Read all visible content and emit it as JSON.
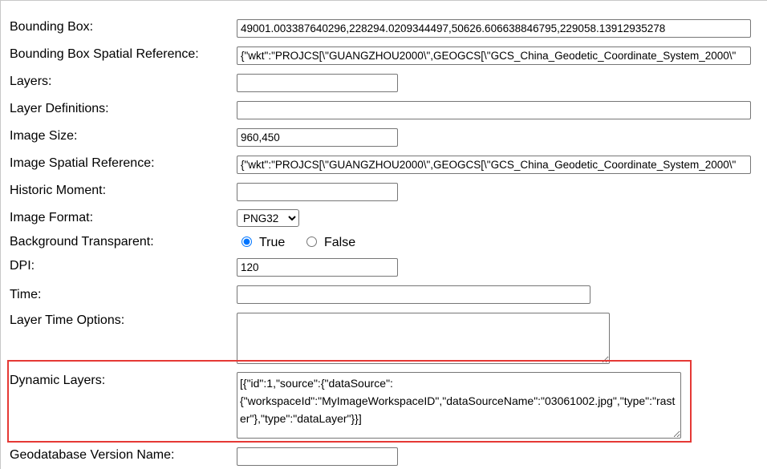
{
  "fields": {
    "bounding_box": {
      "label": "Bounding Box:",
      "value": "49001.003387640296,228294.0209344497,50626.606638846795,229058.13912935278"
    },
    "bbox_sr": {
      "label": "Bounding Box Spatial Reference:",
      "value": "{\"wkt\":\"PROJCS[\\\"GUANGZHOU2000\\\",GEOGCS[\\\"GCS_China_Geodetic_Coordinate_System_2000\\\""
    },
    "layers": {
      "label": "Layers:",
      "value": ""
    },
    "layer_defs": {
      "label": "Layer Definitions:",
      "value": ""
    },
    "image_size": {
      "label": "Image Size:",
      "value": "960,450"
    },
    "image_sr": {
      "label": "Image Spatial Reference:",
      "value": "{\"wkt\":\"PROJCS[\\\"GUANGZHOU2000\\\",GEOGCS[\\\"GCS_China_Geodetic_Coordinate_System_2000\\\""
    },
    "historic_moment": {
      "label": "Historic Moment:",
      "value": ""
    },
    "image_format": {
      "label": "Image Format:",
      "selected": "PNG32"
    },
    "bg_transparent": {
      "label": "Background Transparent:",
      "option_true": "True",
      "option_false": "False",
      "selected": "True"
    },
    "dpi": {
      "label": "DPI:",
      "value": "120"
    },
    "time": {
      "label": "Time:",
      "value": ""
    },
    "layer_time_options": {
      "label": "Layer Time Options:",
      "value": ""
    },
    "dynamic_layers": {
      "label": "Dynamic Layers:",
      "value": "[{\"id\":1,\"source\":{\"dataSource\":{\"workspaceId\":\"MyImageWorkspaceID\",\"dataSourceName\":\"03061002.jpg\",\"type\":\"raster\"},\"type\":\"dataLayer\"}}]"
    },
    "gdb_version": {
      "label": "Geodatabase Version Name:",
      "value": ""
    }
  },
  "colors": {
    "highlight": "#e53935",
    "radio_accent": "#0075ff"
  }
}
